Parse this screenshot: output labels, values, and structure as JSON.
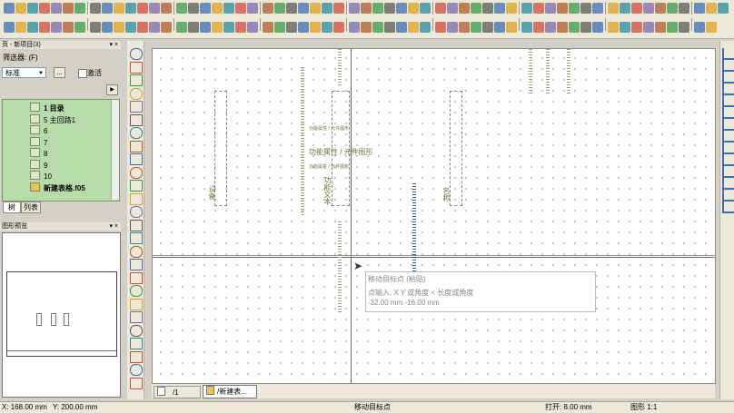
{
  "toolbars": {
    "row1_icon_count": 60,
    "row2_icon_count": 58
  },
  "page_panel": {
    "title": "页 - 新项目(3)",
    "filter_label": "筛选器: (F)",
    "filter_select": "标准",
    "more_button": "...",
    "activate_label": "激活",
    "tree_items": [
      {
        "label": "1 目录",
        "bold": true
      },
      {
        "label": "5 主回路1",
        "bold": false
      },
      {
        "label": "6",
        "bold": false
      },
      {
        "label": "7",
        "bold": false
      },
      {
        "label": "8",
        "bold": false
      },
      {
        "label": "9",
        "bold": false
      },
      {
        "label": "10",
        "bold": false
      },
      {
        "label": "新建表格.f05",
        "bold": true
      }
    ],
    "tabs": [
      "树",
      "列表"
    ]
  },
  "preview_panel": {
    "title": "图形预览"
  },
  "canvas": {
    "center_label": "功能属性 / 元件图形",
    "mid_label_left": "功能属性 / 元件图形",
    "mid_label_right": "功能属性 / 元件图形",
    "vertical_label_left": "设备",
    "vertical_label_center": "功能文本",
    "vertical_label_right": "名称",
    "tooltip": {
      "title": "移动目标点 (粘贴)",
      "hint": "点输入: X Y 或角度 < 长度或角度",
      "coords": "-32.00 mm  -16.00 mm"
    }
  },
  "sheet_tabs": [
    "/1",
    "/新建表..."
  ],
  "status_bar": {
    "x": "X: 168.00 mm",
    "y": "Y: 200.00 mm",
    "mode": "移动目标点",
    "snap": "打开: 8.00 mm",
    "scale": "图形 1:1"
  },
  "colors": {
    "tree_bg": "#b7dca9",
    "canvas_bg": "#ffffff",
    "grid_dot": "#8fa0a8",
    "drawing_text": "#6d7b3a"
  }
}
